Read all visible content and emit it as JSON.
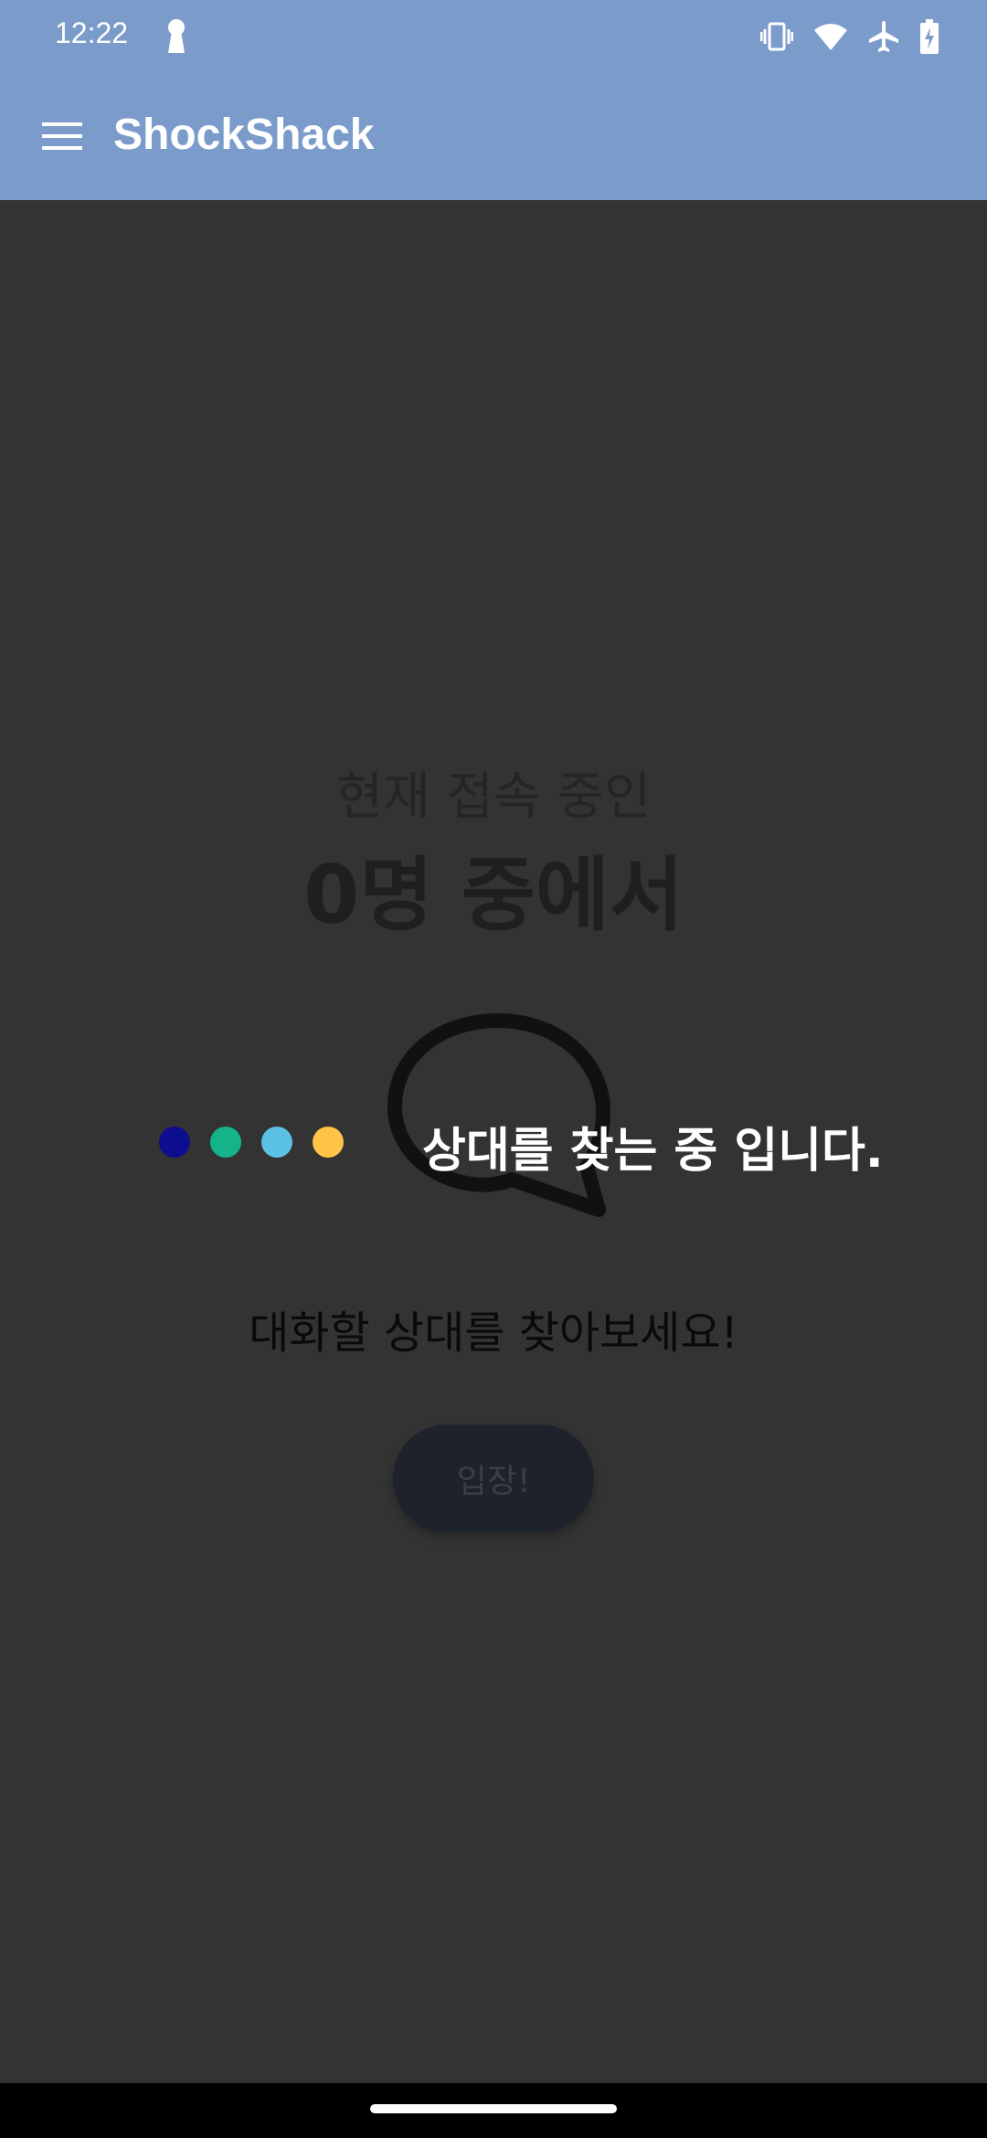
{
  "status_bar": {
    "time": "12:22",
    "icons": [
      "keyhole-icon",
      "vibrate-icon",
      "wifi-icon",
      "airplane-icon",
      "battery-charging-icon"
    ]
  },
  "app_bar": {
    "title": "ShockShack",
    "menu_icon": "hamburger-menu-icon"
  },
  "main": {
    "subtitle": "현재 접속 중인",
    "headline": "0명 중에서",
    "searching_text": "상대를 찾는 중 입니다.",
    "prompt": "대화할 상대를 찾아보세요!",
    "enter_button": "입장!",
    "bubble_icon": "speech-bubble-icon"
  },
  "loading_dots": {
    "colors": [
      "#0D0D8F",
      "#14B38A",
      "#5CC2E5",
      "#FFC445"
    ]
  },
  "colors": {
    "app_bar": "#7B9CCB",
    "background": "#333333",
    "button": "#1E222B"
  }
}
